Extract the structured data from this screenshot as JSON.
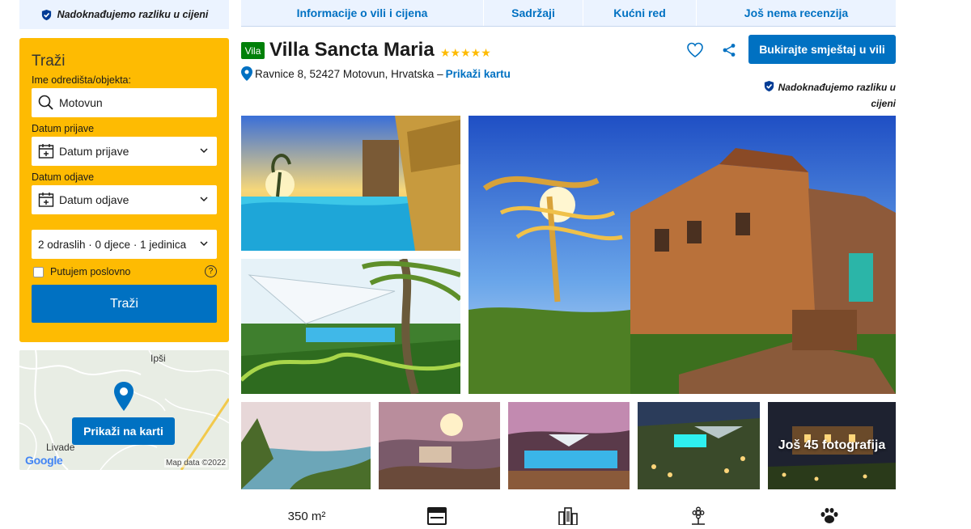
{
  "price_match": {
    "text": "Nadoknađujemo razliku u cijeni"
  },
  "price_match_right": {
    "line1": "Nadoknađujemo razliku u",
    "line2": "cijeni"
  },
  "search": {
    "title": "Traži",
    "destination_label": "Ime odredišta/objekta:",
    "destination_value": "Motovun",
    "checkin_label": "Datum prijave",
    "checkin_placeholder": "Datum prijave",
    "checkout_label": "Datum odjave",
    "checkout_placeholder": "Datum odjave",
    "guests_value": "2 odraslih · 0 djece · 1 jedinica",
    "business_label": "Putujem poslovno",
    "help_glyph": "?",
    "button_label": "Traži"
  },
  "map": {
    "place_top": "Ipši",
    "place_bottom": "Livade",
    "button_label": "Prikaži na karti",
    "google": "Google",
    "map_data": "Map data ©2022"
  },
  "tabs": [
    {
      "label": "Informacije o vili i cijena"
    },
    {
      "label": "Sadržaji"
    },
    {
      "label": "Kućni red"
    },
    {
      "label": "Još nema recenzija"
    }
  ],
  "property": {
    "type_badge": "Vila",
    "name": "Villa Sancta Maria",
    "stars": "★★★★★",
    "address": "Ravnice 8, 52427 Motovun, Hrvatska –",
    "map_link": "Prikaži kartu",
    "book_button": "Bukirajte smještaj u vili"
  },
  "gallery": {
    "more_photos": "Još 45 fotografija"
  },
  "facilities": {
    "area": "350 m²"
  },
  "colors": {
    "brand_blue": "#0071c2",
    "search_yellow": "#febb02",
    "badge_green": "#008009",
    "tab_bg": "#ebf3ff"
  }
}
